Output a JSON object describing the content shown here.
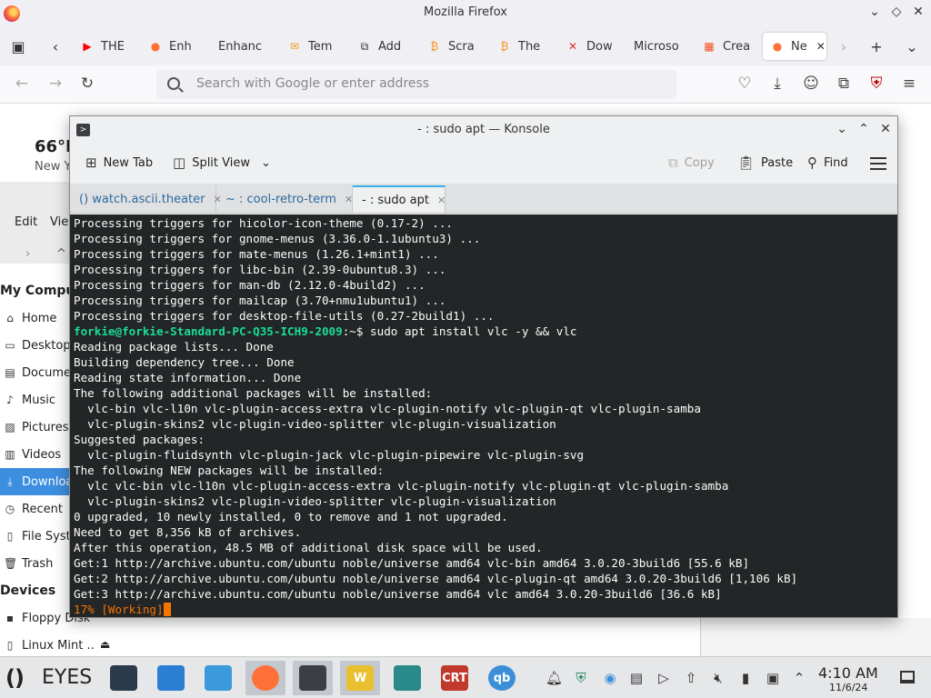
{
  "firefox": {
    "window_title": "Mozilla Firefox",
    "tabs": [
      {
        "label": "THE",
        "icon": "youtube-icon",
        "color": "#ff0000"
      },
      {
        "label": "Enh",
        "icon": "firefox-icon",
        "color": "#ff7139"
      },
      {
        "label": "Enhanc",
        "icon": "",
        "color": "#666666"
      },
      {
        "label": "Tem",
        "icon": "mail-icon",
        "color": "#f0a020"
      },
      {
        "label": "Add",
        "icon": "puzzle-icon",
        "color": "#333333"
      },
      {
        "label": "Scra",
        "icon": "bitcoin-icon",
        "color": "#f7931a"
      },
      {
        "label": "The",
        "icon": "bitcoin-icon",
        "color": "#f7931a"
      },
      {
        "label": "Dow",
        "icon": "x-icon",
        "color": "#e0301e"
      },
      {
        "label": "Microso",
        "icon": "",
        "color": "#666666"
      },
      {
        "label": "Crea",
        "icon": "microsoft-icon",
        "color": "#f25022"
      },
      {
        "label": "Ne",
        "icon": "firefox-icon",
        "color": "#ff7139"
      }
    ],
    "url_placeholder": "Search with Google or enter address"
  },
  "page_behind": {
    "weather_temp": "66°F",
    "weather_location": "New Y"
  },
  "file_manager": {
    "menu_edit": "Edit",
    "menu_view": "View",
    "heading_computer": "My Compute",
    "places": [
      {
        "label": "Home",
        "icon": "home-icon"
      },
      {
        "label": "Desktop",
        "icon": "desktop-icon"
      },
      {
        "label": "Documen",
        "icon": "documents-icon"
      },
      {
        "label": "Music",
        "icon": "music-icon"
      },
      {
        "label": "Pictures",
        "icon": "pictures-icon"
      },
      {
        "label": "Videos",
        "icon": "videos-icon"
      },
      {
        "label": "Downloa",
        "icon": "download-icon"
      },
      {
        "label": "Recent",
        "icon": "recent-icon"
      },
      {
        "label": "File Syste",
        "icon": "drive-icon"
      },
      {
        "label": "Trash",
        "icon": "trash-icon"
      }
    ],
    "heading_devices": "Devices",
    "devices": [
      {
        "label": "Floppy Disk",
        "icon": "floppy-icon"
      },
      {
        "label": "Linux Mint ...",
        "icon": "drive-icon"
      }
    ]
  },
  "konsole": {
    "title": "- : sudo apt — Konsole",
    "toolbar": {
      "new_tab": "New Tab",
      "split_view": "Split View",
      "copy": "Copy",
      "paste": "Paste",
      "find": "Find"
    },
    "tabs": [
      {
        "label": "() watch.ascii.theater"
      },
      {
        "label": "~ : cool-retro-term"
      },
      {
        "label": "- : sudo apt"
      }
    ],
    "terminal": {
      "lines_top": [
        "Processing triggers for hicolor-icon-theme (0.17-2) ...",
        "Processing triggers for gnome-menus (3.36.0-1.1ubuntu3) ...",
        "Processing triggers for mate-menus (1.26.1+mint1) ...",
        "Processing triggers for libc-bin (2.39-0ubuntu8.3) ...",
        "Processing triggers for man-db (2.12.0-4build2) ...",
        "Processing triggers for mailcap (3.70+nmu1ubuntu1) ...",
        "Processing triggers for desktop-file-utils (0.27-2build1) ..."
      ],
      "prompt_user": "forkie@forkie-Standard-PC-Q35-ICH9-2009",
      "prompt_rest": ":~$ sudo apt install vlc -y && vlc",
      "lines_bottom": [
        "Reading package lists... Done",
        "Building dependency tree... Done",
        "Reading state information... Done",
        "The following additional packages will be installed:",
        "  vlc-bin vlc-l10n vlc-plugin-access-extra vlc-plugin-notify vlc-plugin-qt vlc-plugin-samba",
        "  vlc-plugin-skins2 vlc-plugin-video-splitter vlc-plugin-visualization",
        "Suggested packages:",
        "  vlc-plugin-fluidsynth vlc-plugin-jack vlc-plugin-pipewire vlc-plugin-svg",
        "The following NEW packages will be installed:",
        "  vlc vlc-bin vlc-l10n vlc-plugin-access-extra vlc-plugin-notify vlc-plugin-qt vlc-plugin-samba",
        "  vlc-plugin-skins2 vlc-plugin-video-splitter vlc-plugin-visualization",
        "0 upgraded, 10 newly installed, 0 to remove and 1 not upgraded.",
        "Need to get 8,356 kB of archives.",
        "After this operation, 48.5 MB of additional disk space will be used.",
        "Get:1 http://archive.ubuntu.com/ubuntu noble/universe amd64 vlc-bin amd64 3.0.20-3build6 [55.6 kB]",
        "Get:2 http://archive.ubuntu.com/ubuntu noble/universe amd64 vlc-plugin-qt amd64 3.0.20-3build6 [1,106 kB]",
        "Get:3 http://archive.ubuntu.com/ubuntu noble/universe amd64 vlc amd64 3.0.20-3build6 [36.6 kB]"
      ],
      "progress": "17% [Working]"
    }
  },
  "taskbar": {
    "brand": "EYES",
    "apps": [
      {
        "name": "settings",
        "label": "",
        "color": "#2b3a4a"
      },
      {
        "name": "software-store",
        "label": "",
        "color": "#2a7fd4"
      },
      {
        "name": "files",
        "label": "",
        "color": "#3b9ad9"
      },
      {
        "name": "firefox",
        "label": "",
        "color": "#ff7139"
      },
      {
        "name": "konsole",
        "label": "",
        "color": "#3b3f43"
      },
      {
        "name": "w-app",
        "label": "W",
        "color": "#e8c030"
      },
      {
        "name": "kdeconnect",
        "label": "",
        "color": "#2a8a8a"
      },
      {
        "name": "cool-retro-term",
        "label": "CRT",
        "color": "#c0392b"
      },
      {
        "name": "qbittorrent",
        "label": "qb",
        "color": "#3b8fd8"
      }
    ],
    "clock_time": "4:10 AM",
    "clock_date": "11/6/24"
  }
}
